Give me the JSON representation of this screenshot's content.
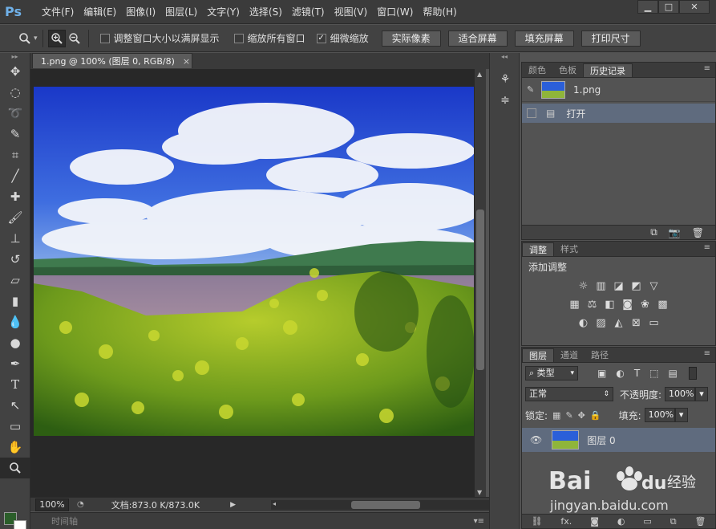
{
  "app": {
    "logo": "Ps"
  },
  "menu": [
    "文件(F)",
    "编辑(E)",
    "图像(I)",
    "图层(L)",
    "文字(Y)",
    "选择(S)",
    "滤镜(T)",
    "视图(V)",
    "窗口(W)",
    "帮助(H)"
  ],
  "window_controls": {
    "minimize": "▁",
    "maximize": "□",
    "close": "✕"
  },
  "options": {
    "cb_resize_window": {
      "label": "调整窗口大小以满屏显示",
      "checked": false
    },
    "cb_zoom_all": {
      "label": "缩放所有窗口",
      "checked": false
    },
    "cb_scrubby": {
      "label": "细微缩放",
      "checked": true
    },
    "btn_actual": "实际像素",
    "btn_fit": "适合屏幕",
    "btn_fill": "填充屏幕",
    "btn_print": "打印尺寸"
  },
  "document": {
    "tab_title": "1.png @ 100% (图层 0, RGB/8)",
    "tab_close": "×",
    "zoom": "100%",
    "doc_info": "文档:873.0 K/873.0K"
  },
  "timeline": {
    "label": "时间轴"
  },
  "history_panel": {
    "tabs": [
      "颜色",
      "色板",
      "历史记录"
    ],
    "active_tab": 2,
    "snapshot": "1.png",
    "entries": [
      "打开"
    ]
  },
  "adjust_panel": {
    "tabs": [
      "调整",
      "样式"
    ],
    "active_tab": 0,
    "heading": "添加调整"
  },
  "layers_panel": {
    "tabs": [
      "图层",
      "通道",
      "路径"
    ],
    "active_tab": 0,
    "filter_kind": "类型",
    "blend_mode": "正常",
    "opacity_label": "不透明度:",
    "opacity": "100%",
    "lock_label": "锁定:",
    "fill_label": "填充:",
    "fill": "100%",
    "layers": [
      "图层 0"
    ],
    "footer_icons": [
      "link-icon",
      "fx",
      "mask-icon",
      "adjustment-icon",
      "folder-icon",
      "new-layer-icon",
      "trash-icon"
    ],
    "fx_label": "fx."
  },
  "watermark": {
    "brand": "Bai",
    "brand2": "du",
    "cn": "经验",
    "url": "jingyan.baidu.com"
  }
}
